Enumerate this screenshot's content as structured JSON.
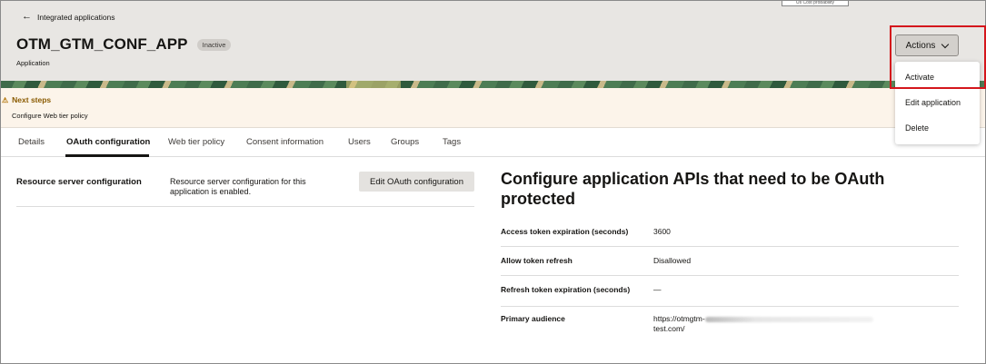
{
  "header": {
    "back_link": "Integrated applications",
    "app_title": "OTM_GTM_CONF_APP",
    "status": "Inactive",
    "subtitle": "Application",
    "tooltip_fragment": "Us Cost probability"
  },
  "actions": {
    "button_label": "Actions",
    "menu": [
      "Activate",
      "Edit application",
      "Delete"
    ]
  },
  "next_steps": {
    "title": "Next steps",
    "text": "Configure Web tier policy"
  },
  "tabs": [
    "Details",
    "OAuth configuration",
    "Web tier policy",
    "Consent information",
    "Users",
    "Groups",
    "Tags"
  ],
  "active_tab": "OAuth configuration",
  "resource_server": {
    "label": "Resource server configuration",
    "description": "Resource server configuration for this application is enabled.",
    "edit_button": "Edit OAuth configuration"
  },
  "configure": {
    "title": "Configure application APIs that need to be OAuth protected",
    "rows": [
      {
        "key": "Access token expiration (seconds)",
        "value": "3600"
      },
      {
        "key": "Allow token refresh",
        "value": "Disallowed"
      },
      {
        "key": "Refresh token expiration (seconds)",
        "value": "—"
      },
      {
        "key": "Primary audience",
        "value_line1": "https://otmgtm-",
        "value_line2": "test.com/"
      }
    ]
  },
  "colors": {
    "highlight": "#d4161c",
    "next_steps_title": "#8a5a00",
    "header_bg": "#e8e6e3"
  },
  "icons": {
    "back": "arrow-left-icon",
    "warning": "warning-triangle-icon",
    "actions": "chevron-down-icon"
  }
}
